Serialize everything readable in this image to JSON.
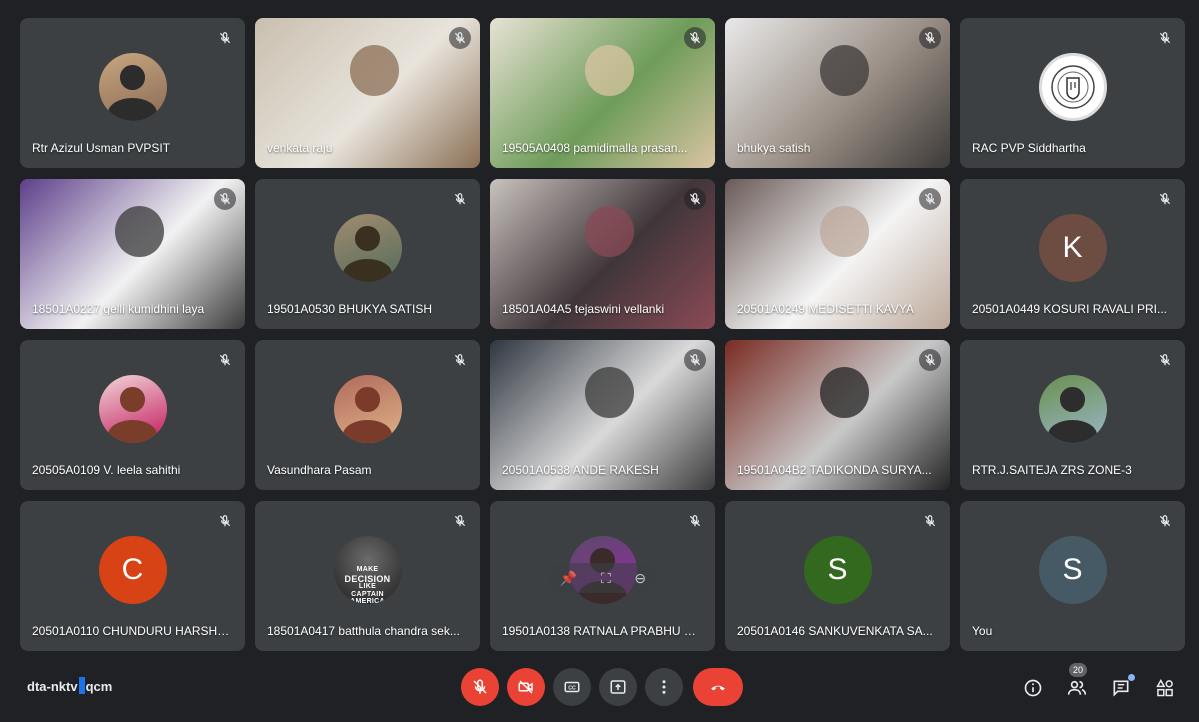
{
  "meeting": {
    "code_before_cursor": "dta-nktv",
    "code_after_cursor": "qcm"
  },
  "participants": [
    {
      "name": "Rtr Azizul Usman PVPSIT",
      "kind": "avatar-photo",
      "icon": "person-photo-avatar",
      "muted": true
    },
    {
      "name": "venkata raju",
      "kind": "video",
      "muted": true
    },
    {
      "name": "19505A0408 pamidimalla prasan...",
      "kind": "video",
      "muted": true
    },
    {
      "name": "bhukya satish",
      "kind": "video",
      "muted": true
    },
    {
      "name": "RAC PVP Siddhartha",
      "kind": "avatar-logo",
      "icon": "club-logo-avatar",
      "muted": true
    },
    {
      "name": "18501A0227 gelli kumidhini laya",
      "kind": "video",
      "muted": true
    },
    {
      "name": "19501A0530 BHUKYA SATISH",
      "kind": "avatar-photo",
      "icon": "person-photo-avatar",
      "muted": true
    },
    {
      "name": "18501A04A5 tejaswini vellanki",
      "kind": "video",
      "muted": true
    },
    {
      "name": "20501A0249 MEDISETTI KAVYA",
      "kind": "video",
      "muted": true
    },
    {
      "name": "20501A0449 KOSURI RAVALI PRI...",
      "kind": "avatar-letter",
      "letter": "K",
      "color": "#6d4c41",
      "muted": true
    },
    {
      "name": "20505A0109 V. leela sahithi",
      "kind": "avatar-photo",
      "icon": "person-photo-avatar",
      "muted": true
    },
    {
      "name": "Vasundhara Pasam",
      "kind": "avatar-photo",
      "icon": "cartoon-girl-avatar",
      "muted": true
    },
    {
      "name": "20501A0538 ANDE RAKESH",
      "kind": "video",
      "muted": true
    },
    {
      "name": "19501A04B2 TADIKONDA SURYA...",
      "kind": "video",
      "muted": true
    },
    {
      "name": "RTR.J.SAITEJA ZRS ZONE-3",
      "kind": "avatar-photo",
      "icon": "person-photo-avatar",
      "muted": true
    },
    {
      "name": "20501A0110 CHUNDURU HARSHA ...",
      "kind": "avatar-letter",
      "letter": "C",
      "color": "#d84315",
      "muted": true
    },
    {
      "name": "18501A0417 batthula chandra sek...",
      "kind": "avatar-poster",
      "icon": "movie-poster-avatar",
      "poster_lines": [
        "MAKE",
        "DECISION",
        "LIKE",
        "CAPTAIN AMERICA"
      ],
      "muted": true
    },
    {
      "name": "19501A0138 RATNALA PRABHU K...",
      "kind": "avatar-photo",
      "icon": "person-photo-avatar",
      "muted": true,
      "hover_controls": true
    },
    {
      "name": "20501A0146 SANKUVENKATA SA...",
      "kind": "avatar-letter",
      "letter": "S",
      "color": "#33691e",
      "muted": true
    },
    {
      "name": "You",
      "kind": "avatar-letter",
      "letter": "S",
      "color": "#455a64",
      "muted": true
    }
  ],
  "toolbar": {
    "mic": {
      "icon": "mic-off-icon",
      "color": "#ea4335"
    },
    "camera": {
      "icon": "camera-off-icon",
      "color": "#ea4335"
    },
    "captions": {
      "icon": "captions-icon"
    },
    "present": {
      "icon": "present-screen-icon"
    },
    "more": {
      "icon": "more-options-icon"
    },
    "hangup": {
      "icon": "hang-up-icon",
      "color": "#ea4335"
    }
  },
  "side_tools": {
    "info": {
      "icon": "info-icon"
    },
    "people": {
      "icon": "people-icon",
      "count": "20"
    },
    "chat": {
      "icon": "chat-icon"
    },
    "activities": {
      "icon": "activities-icon"
    }
  }
}
